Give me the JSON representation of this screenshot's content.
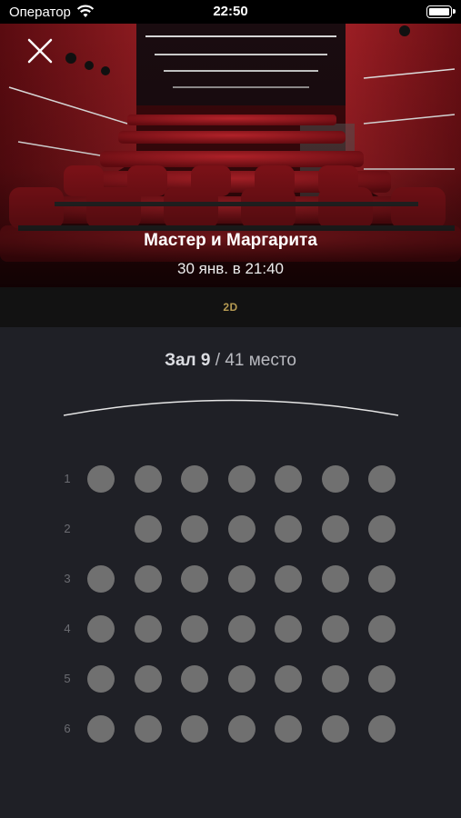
{
  "status_bar": {
    "carrier": "Оператор",
    "time": "22:50",
    "wifi_icon": "wifi-icon",
    "battery_icon": "battery-icon"
  },
  "header": {
    "close_icon": "close-icon",
    "movie_title": "Мастер и Маргарита",
    "showtime": "30 янв. в 21:40",
    "format": "2D"
  },
  "hall": {
    "name": "Зал 9",
    "separator": " / ",
    "seats": "41 место"
  },
  "seat_map": {
    "seat_color": "#707070",
    "rows": [
      {
        "label": "1",
        "seats": [
          1,
          1,
          1,
          1,
          1,
          1,
          1
        ]
      },
      {
        "label": "2",
        "seats": [
          0,
          1,
          1,
          1,
          1,
          1,
          1
        ]
      },
      {
        "label": "3",
        "seats": [
          1,
          1,
          1,
          1,
          1,
          1,
          1
        ]
      },
      {
        "label": "4",
        "seats": [
          1,
          1,
          1,
          1,
          1,
          1,
          1
        ]
      },
      {
        "label": "5",
        "seats": [
          1,
          1,
          1,
          1,
          1,
          1,
          1
        ]
      },
      {
        "label": "6",
        "seats": [
          1,
          1,
          1,
          1,
          1,
          1,
          1
        ]
      }
    ]
  }
}
